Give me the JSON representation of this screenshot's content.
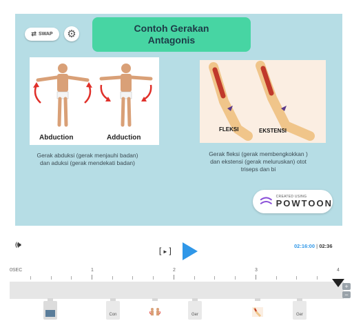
{
  "slide": {
    "swap_label": "SWAP",
    "title_line1": "Contoh Gerakan",
    "title_line2": "Antagonis",
    "left_image": {
      "caption_a": "Abduction",
      "caption_b": "Adduction"
    },
    "right_image": {
      "caption_a": "FLEKSI",
      "caption_b": "EKSTENSI"
    },
    "left_text": "Gerak abduksi (gerak menjauhi badan) dan aduksi (gerak mendekati badan)",
    "right_text": "Gerak fleksi (gerak membengkokkan ) dan ekstensi (gerak meluruskan) otot triseps dan bi",
    "watermark_small": "CREATED USING",
    "watermark_big": "POWTOON"
  },
  "player": {
    "step_label": "[▸]",
    "current_time": "02:16:00",
    "separator": "|",
    "total_time": "02:36"
  },
  "timeline": {
    "labels": [
      "0SEC",
      "1",
      "2",
      "3",
      "4"
    ],
    "thumbnails": [
      "",
      "Con",
      "",
      "Ger",
      "",
      "Ger"
    ]
  },
  "icons": [
    "swap-icon",
    "gear-icon",
    "volume-icon",
    "play-icon",
    "zoom-in-icon",
    "zoom-out-icon",
    "powtoon-logo-icon"
  ],
  "colors": {
    "slide_bg": "#b6dde5",
    "title_bg": "#47d5a3",
    "accent": "#2f97e8"
  }
}
